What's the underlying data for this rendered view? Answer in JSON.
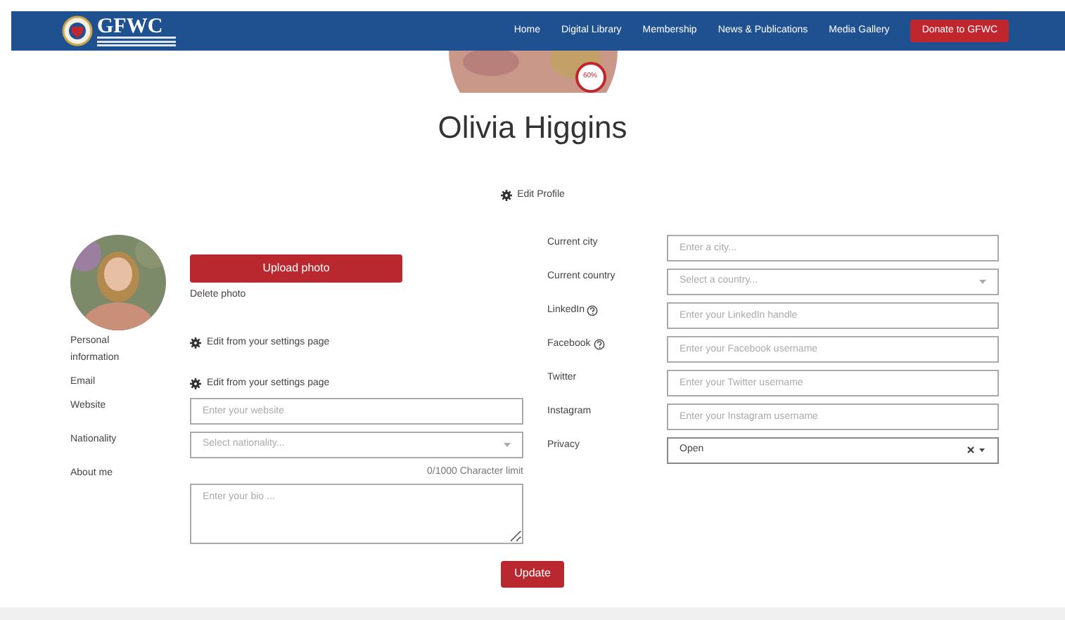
{
  "nav": {
    "logo": "GFWC",
    "links": [
      "Home",
      "Digital Library",
      "Membership",
      "News & Publications",
      "Media Gallery"
    ],
    "donate": "Donate to GFWC"
  },
  "profile": {
    "completion": "60%",
    "name": "Olivia Higgins",
    "edit_profile": "Edit Profile"
  },
  "photo": {
    "upload": "Upload photo",
    "delete": "Delete photo"
  },
  "left_fields": [
    {
      "kind": "note",
      "label": "Personal information",
      "text": "Edit from your settings page"
    },
    {
      "kind": "note",
      "label": "Email",
      "text": "Edit from your settings page"
    },
    {
      "kind": "input",
      "label": "Website",
      "placeholder": "Enter your website"
    },
    {
      "kind": "select",
      "label": "Nationality",
      "placeholder": "Select nationality..."
    },
    {
      "kind": "textarea",
      "label": "About me",
      "counter": "0/1000 Character limit",
      "placeholder": "Enter your bio ..."
    }
  ],
  "right_fields": [
    {
      "kind": "input",
      "label": "Current city",
      "help": false,
      "placeholder": "Enter a city..."
    },
    {
      "kind": "select",
      "label": "Current country",
      "help": false,
      "placeholder": "Select a country..."
    },
    {
      "kind": "input",
      "label": "LinkedIn",
      "help": true,
      "placeholder": "Enter your LinkedIn handle"
    },
    {
      "kind": "input",
      "label": "Facebook",
      "help": true,
      "placeholder": "Enter your Facebook username"
    },
    {
      "kind": "input",
      "label": "Twitter",
      "help": false,
      "placeholder": "Enter your Twitter username"
    },
    {
      "kind": "input",
      "label": "Instagram",
      "help": false,
      "placeholder": "Enter your Instagram username"
    },
    {
      "kind": "value-select",
      "label": "Privacy",
      "help": false,
      "value": "Open"
    }
  ],
  "update": "Update"
}
